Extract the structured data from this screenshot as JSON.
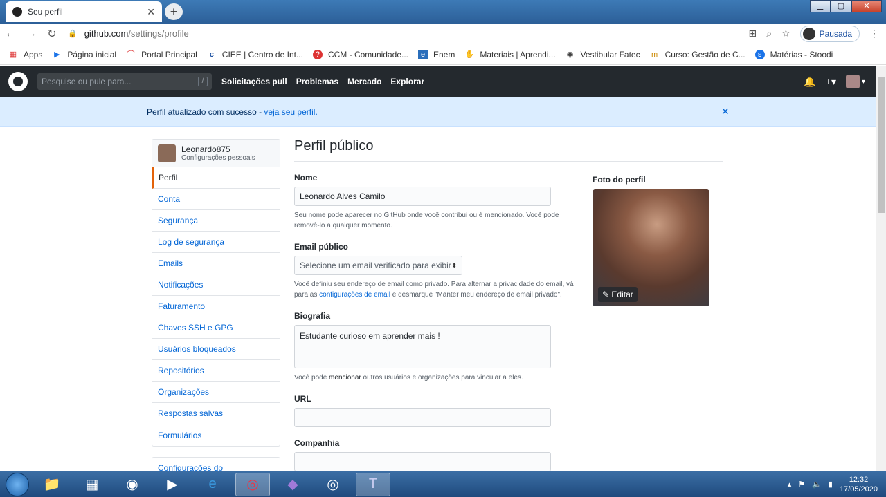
{
  "browser": {
    "tab_title": "Seu perfil",
    "url_host": "github.com",
    "url_path": "/settings/profile",
    "profile_label": "Pausada",
    "bookmarks": [
      {
        "label": "Apps",
        "icon": "apps-grid-icon"
      },
      {
        "label": "Página inicial",
        "icon": "play-icon"
      },
      {
        "label": "Portal Principal",
        "icon": "portal-icon"
      },
      {
        "label": "CIEE | Centro de Int...",
        "icon": "ciee-icon"
      },
      {
        "label": "CCM - Comunidade...",
        "icon": "ccm-icon"
      },
      {
        "label": "Enem",
        "icon": "enem-icon"
      },
      {
        "label": "Materiais | Aprendi...",
        "icon": "hand-icon"
      },
      {
        "label": "Vestibular Fatec",
        "icon": "fatec-icon"
      },
      {
        "label": "Curso: Gestão de C...",
        "icon": "course-icon"
      },
      {
        "label": "Matérias - Stoodi",
        "icon": "stoodi-icon"
      }
    ]
  },
  "header": {
    "search_placeholder": "Pesquise ou pule para...",
    "search_key": "/",
    "nav": [
      "Solicitações pull",
      "Problemas",
      "Mercado",
      "Explorar"
    ]
  },
  "flash": {
    "message": "Perfil atualizado com sucesso - ",
    "link": "veja seu perfil."
  },
  "sidebar": {
    "username": "Leonardo875",
    "subtitle": "Configurações pessoais",
    "items": [
      "Perfil",
      "Conta",
      "Segurança",
      "Log de segurança",
      "Emails",
      "Notificações",
      "Faturamento",
      "Chaves SSH e GPG",
      "Usuários bloqueados",
      "Repositórios",
      "Organizações",
      "Respostas salvas",
      "Formulários"
    ],
    "active_index": 0,
    "second_box_item": "Configurações do"
  },
  "main": {
    "title": "Perfil público",
    "name_label": "Nome",
    "name_value": "Leonardo Alves Camilo",
    "name_note": "Seu nome pode aparecer no GitHub onde você contribui ou é mencionado. Você pode removê-lo a qualquer momento.",
    "email_label": "Email público",
    "email_select": "Selecione um email verificado para exibir",
    "email_note_1": "Você definiu seu endereço de email como privado. Para alternar a privacidade do email, vá para as ",
    "email_note_link": "configurações de email",
    "email_note_2": " e desmarque \"Manter meu endereço de email privado\".",
    "bio_label": "Biografia",
    "bio_value": "Estudante curioso em aprender mais !",
    "bio_note_1": "Você pode ",
    "bio_note_bold": "mencionar",
    "bio_note_2": " outros usuários e organizações para vincular a eles.",
    "url_label": "URL",
    "url_value": "",
    "company_label": "Companhia",
    "company_value": "",
    "photo_label": "Foto do perfil",
    "photo_edit": "Editar"
  },
  "taskbar": {
    "time": "12:32",
    "date": "17/05/2020"
  }
}
